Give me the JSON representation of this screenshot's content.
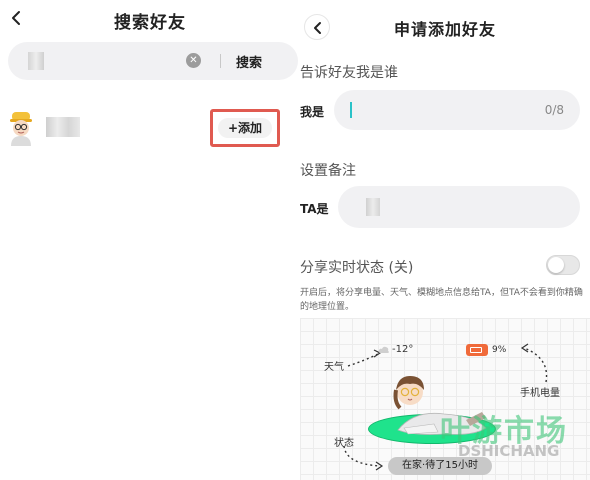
{
  "left": {
    "title": "搜索好友",
    "search": {
      "button_label": "搜索"
    },
    "result": {
      "add_label": "+添加"
    }
  },
  "right": {
    "title": "申请添加好友",
    "section_intro": "告诉好友我是谁",
    "field_self": {
      "label": "我是",
      "counter": "0/8"
    },
    "section_remark": "设置备注",
    "field_remark": {
      "label": "TA是"
    },
    "share_status": {
      "label": "分享实时状态 (关)",
      "enabled": false
    },
    "description": "开启后，将分享电量、天气、模糊地点信息给TA，但TA不会看到你精确的地理位置。",
    "illustration": {
      "weather_label": "天气",
      "temperature": "-12°",
      "battery_percent": "9%",
      "phone_battery_label": "手机电量",
      "status_label": "状态",
      "status_value": "在家·待了15小时"
    }
  },
  "watermark": {
    "text": "叶游市场",
    "sub": "DSHICHANG"
  },
  "colors": {
    "add_border": "#e05a50",
    "caret": "#2ac2c8",
    "disc": "#1fe38c",
    "battery": "#f06a3a"
  }
}
